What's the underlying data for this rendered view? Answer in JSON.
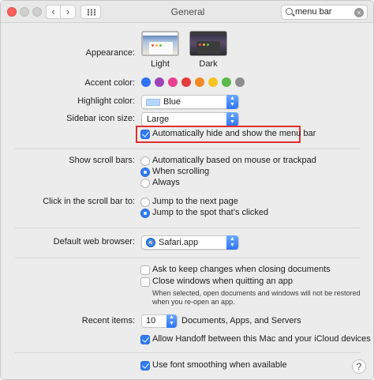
{
  "window": {
    "title": "General",
    "back_glyph": "‹",
    "forward_glyph": "›",
    "search_value": "menu bar",
    "search_clear_glyph": "×"
  },
  "appearance": {
    "label": "Appearance:",
    "options": [
      {
        "name": "Light",
        "selected": true
      },
      {
        "name": "Dark",
        "selected": false
      }
    ]
  },
  "accent": {
    "label": "Accent color:",
    "colors": [
      "#2b6ff6",
      "#9b44b7",
      "#e8418f",
      "#e23c3c",
      "#f48a25",
      "#f4c423",
      "#5cb94a",
      "#8c8c8c"
    ],
    "selected_index": 0
  },
  "highlight": {
    "label": "Highlight color:",
    "value": "Blue",
    "chip_color": "#b3d7ff"
  },
  "sidebar_icon": {
    "label": "Sidebar icon size:",
    "value": "Large"
  },
  "menu_bar": {
    "label": "Automatically hide and show the menu bar",
    "checked": true
  },
  "scroll_bars": {
    "label": "Show scroll bars:",
    "options": [
      "Automatically based on mouse or trackpad",
      "When scrolling",
      "Always"
    ],
    "selected_index": 1
  },
  "click_scroll": {
    "label": "Click in the scroll bar to:",
    "options": [
      "Jump to the next page",
      "Jump to the spot that’s clicked"
    ],
    "selected_index": 1
  },
  "browser": {
    "label": "Default web browser:",
    "value": "Safari.app"
  },
  "documents": {
    "ask_keep": "Ask to keep changes when closing documents",
    "close_windows": "Close windows when quitting an app",
    "note_line1": "When selected, open documents and windows will not be restored",
    "note_line2": "when you re-open an app."
  },
  "recent": {
    "label": "Recent items:",
    "value": "10",
    "suffix": "Documents, Apps, and Servers"
  },
  "handoff": {
    "label": "Allow Handoff between this Mac and your iCloud devices",
    "checked": true
  },
  "font_smoothing": {
    "label": "Use font smoothing when available",
    "checked": true
  },
  "help_glyph": "?"
}
